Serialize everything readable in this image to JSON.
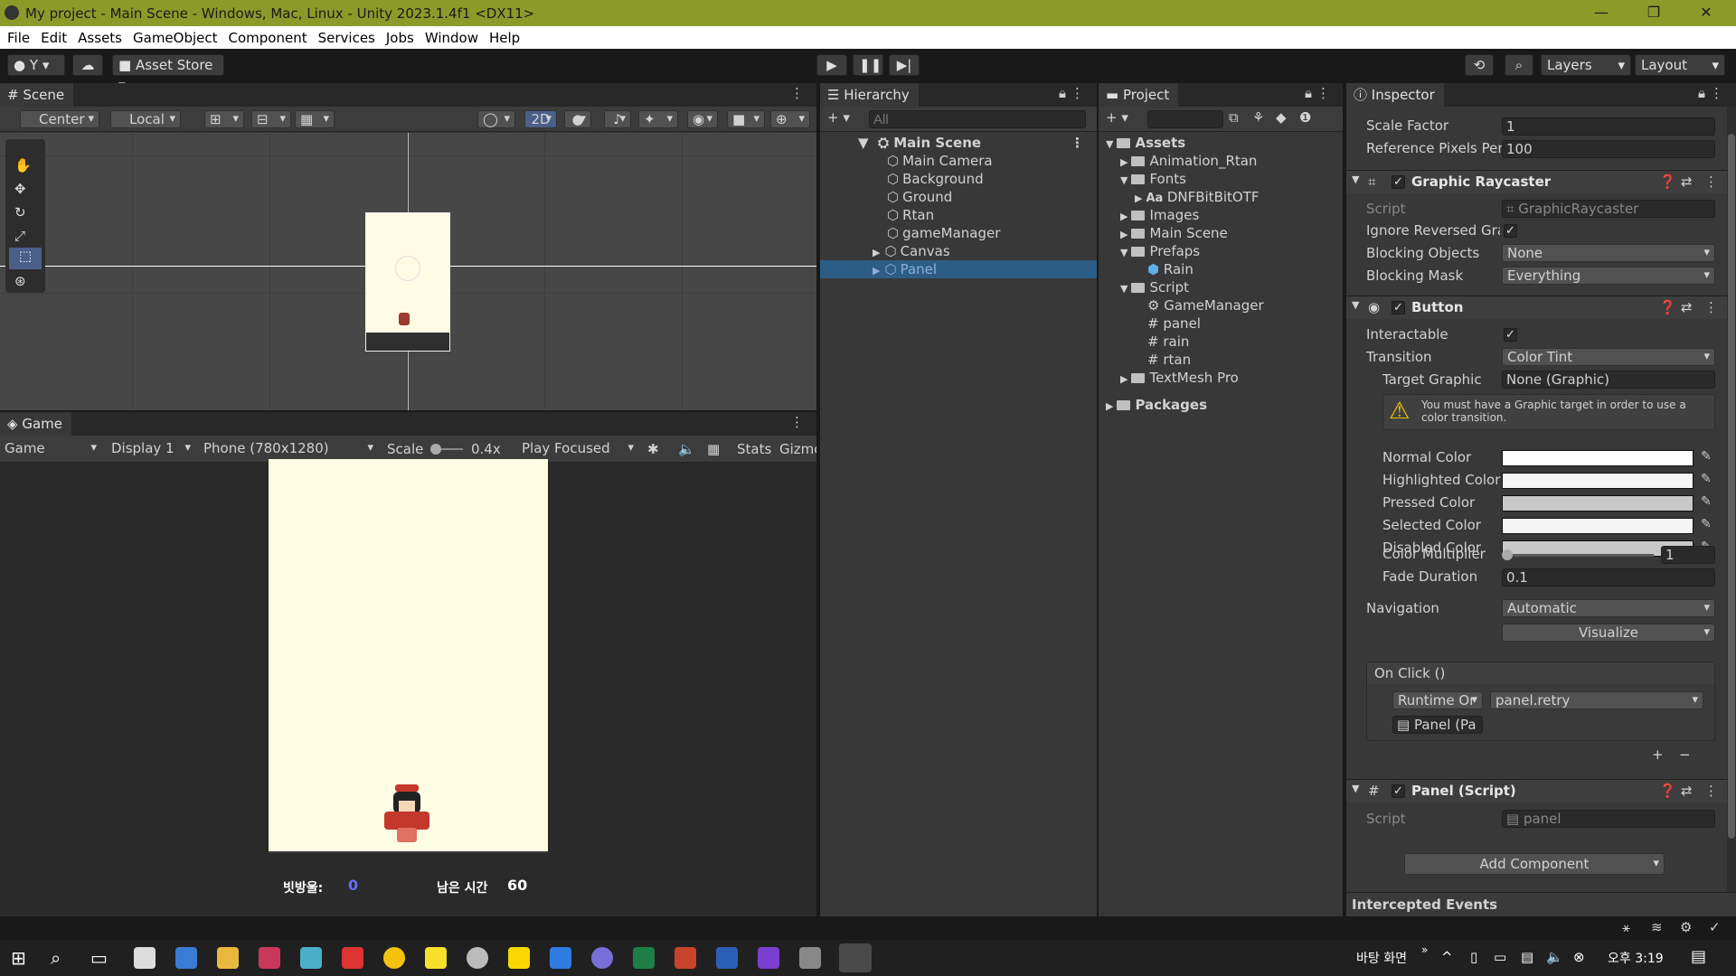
{
  "window": {
    "title": "My project - Main Scene - Windows, Mac, Linux - Unity 2023.1.4f1 <DX11>",
    "minimize": "—",
    "restore": "❐",
    "close": "✕"
  },
  "menu": [
    "File",
    "Edit",
    "Assets",
    "GameObject",
    "Component",
    "Services",
    "Jobs",
    "Window",
    "Help"
  ],
  "toolbar": {
    "account": "Y",
    "asset_store": "Asset Store",
    "layers": "Layers",
    "layout": "Layout"
  },
  "scene": {
    "tab": "Scene",
    "pivot": "Center",
    "space": "Local",
    "mode2d": "2D"
  },
  "game": {
    "tab": "Game",
    "view": "Game",
    "display": "Display 1",
    "resolution": "Phone (780x1280)",
    "scale_label": "Scale",
    "scale_value": "0.4x",
    "play_focus": "Play Focused",
    "stats": "Stats",
    "gizmos": "Gizmo",
    "hud": {
      "score_label": "빗방울:",
      "score_value": "0",
      "time_label": "남은 시간",
      "time_value": "60"
    }
  },
  "hierarchy": {
    "tab": "Hierarchy",
    "search_placeholder": "All",
    "scene_name": "Main Scene",
    "items": [
      "Main Camera",
      "Background",
      "Ground",
      "Rtan",
      "gameManager",
      "Canvas",
      "Panel"
    ],
    "selected": "Panel"
  },
  "project": {
    "tab": "Project",
    "root": "Assets",
    "items": [
      {
        "label": "Animation_Rtan",
        "depth": 1,
        "kind": "folder"
      },
      {
        "label": "Fonts",
        "depth": 1,
        "kind": "folder"
      },
      {
        "label": "DNFBitBitOTF",
        "depth": 2,
        "kind": "font"
      },
      {
        "label": "Images",
        "depth": 1,
        "kind": "folder"
      },
      {
        "label": "Main Scene",
        "depth": 1,
        "kind": "folder"
      },
      {
        "label": "Prefaps",
        "depth": 1,
        "kind": "folder"
      },
      {
        "label": "Rain",
        "depth": 2,
        "kind": "prefab"
      },
      {
        "label": "Script",
        "depth": 1,
        "kind": "folder"
      },
      {
        "label": "GameManager",
        "depth": 2,
        "kind": "gear"
      },
      {
        "label": "panel",
        "depth": 2,
        "kind": "script"
      },
      {
        "label": "rain",
        "depth": 2,
        "kind": "script"
      },
      {
        "label": "rtan",
        "depth": 2,
        "kind": "script"
      },
      {
        "label": "TextMesh Pro",
        "depth": 1,
        "kind": "folder"
      }
    ],
    "packages": "Packages"
  },
  "inspector": {
    "tab": "Inspector",
    "scale_factor_label": "Scale Factor",
    "scale_factor": "1",
    "ref_ppu_label": "Reference Pixels Per",
    "ref_ppu": "100",
    "raycaster": {
      "title": "Graphic Raycaster",
      "script_label": "Script",
      "script": "GraphicRaycaster",
      "ignore_label": "Ignore Reversed Grap",
      "blocking_objects_label": "Blocking Objects",
      "blocking_objects": "None",
      "blocking_mask_label": "Blocking Mask",
      "blocking_mask": "Everything"
    },
    "button": {
      "title": "Button",
      "interactable_label": "Interactable",
      "transition_label": "Transition",
      "transition": "Color Tint",
      "target_label": "Target Graphic",
      "target": "None (Graphic)",
      "warning": "You must have a Graphic target in order to use a color transition.",
      "colors": [
        {
          "label": "Normal Color",
          "color": "#ffffff"
        },
        {
          "label": "Highlighted Color",
          "color": "#f5f5f5"
        },
        {
          "label": "Pressed Color",
          "color": "#c8c8c8"
        },
        {
          "label": "Selected Color",
          "color": "#f5f5f5"
        },
        {
          "label": "Disabled Color",
          "color": "#c8c8c8"
        }
      ],
      "multiplier_label": "Color Multiplier",
      "multiplier": "1",
      "fade_label": "Fade Duration",
      "fade": "0.1",
      "navigation_label": "Navigation",
      "navigation": "Automatic",
      "visualize": "Visualize",
      "onclick": "On Click ()",
      "runtime": "Runtime Or",
      "method": "panel.retry",
      "object": "Panel (Pa"
    },
    "panel_script": {
      "title": "Panel (Script)",
      "script_label": "Script",
      "script": "panel"
    },
    "add_component": "Add Component",
    "intercepted": "Intercepted Events"
  },
  "taskbar": {
    "desktop": "바탕 화면",
    "chevron": "»",
    "time": "오후 3:19"
  }
}
